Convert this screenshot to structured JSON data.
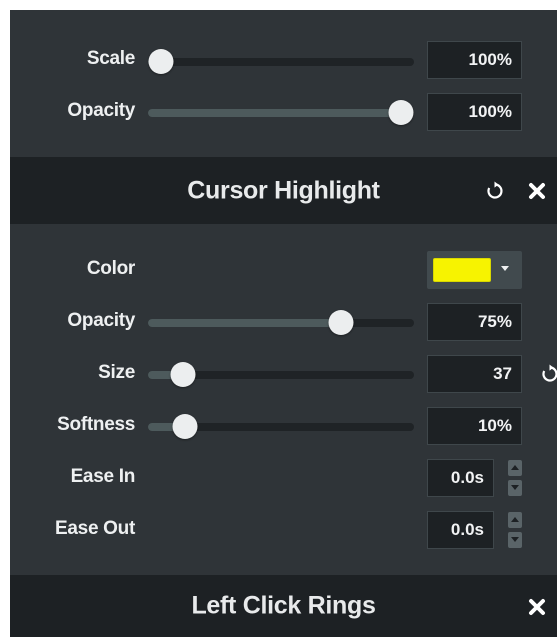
{
  "top_section": {
    "scale": {
      "label": "Scale",
      "value_text": "100%",
      "level": 0.0
    },
    "opacity": {
      "label": "Opacity",
      "value_text": "100%",
      "level": 1.0
    }
  },
  "cursor_highlight": {
    "title": "Cursor Highlight",
    "reset_icon": "reset-icon",
    "close_icon": "close-icon",
    "color": {
      "label": "Color",
      "swatch": "#f7f300"
    },
    "opacity": {
      "label": "Opacity",
      "value_text": "75%",
      "level": 0.75
    },
    "size": {
      "label": "Size",
      "value_text": "37",
      "level": 0.09
    },
    "softness": {
      "label": "Softness",
      "value_text": "10%",
      "level": 0.1
    },
    "ease_in": {
      "label": "Ease In",
      "value_text": "0.0s"
    },
    "ease_out": {
      "label": "Ease Out",
      "value_text": "0.0s"
    }
  },
  "left_click_rings": {
    "title": "Left Click Rings",
    "close_icon": "close-icon"
  }
}
